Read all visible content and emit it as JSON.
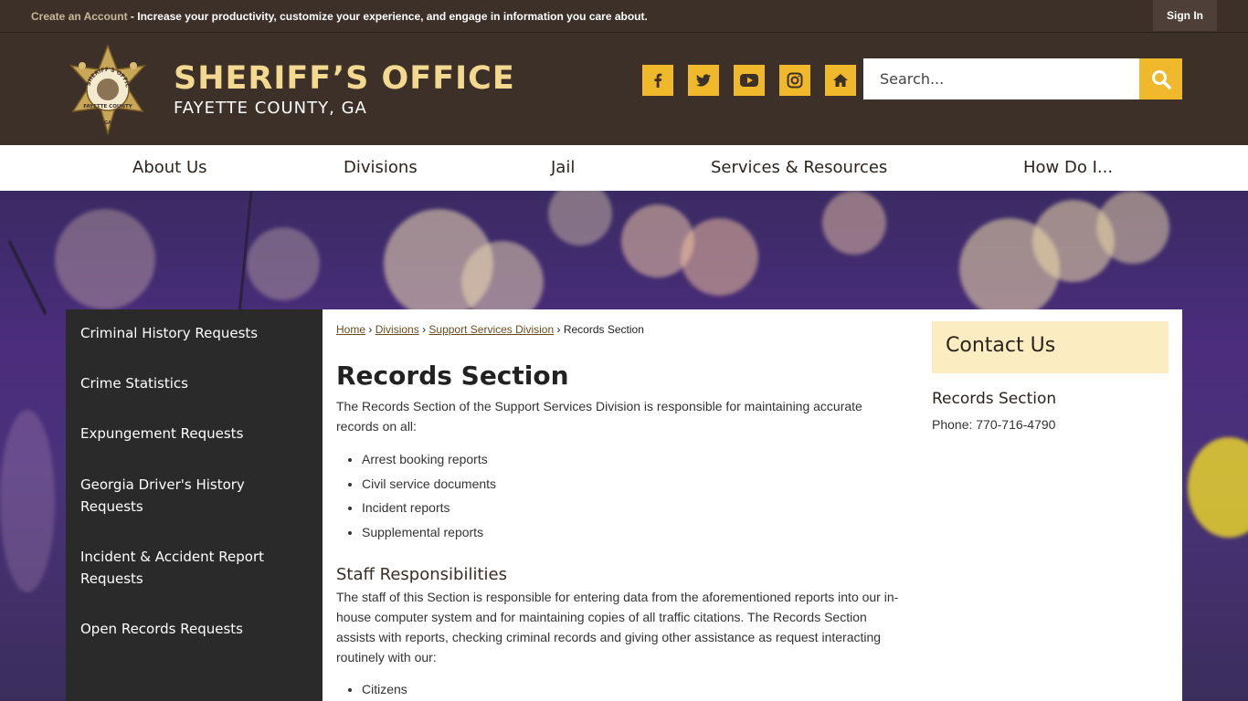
{
  "topbar": {
    "create_link": "Create an Account",
    "message": " - Increase your productivity, customize your experience, and engage in information you care about.",
    "sign_in": "Sign In"
  },
  "header": {
    "title": "SHERIFF’S OFFICE",
    "subtitle": "FAYETTE COUNTY, GA",
    "badge_text": [
      "SHERIFF'S OFFICE",
      "FAYETTE COUNTY",
      "GA"
    ],
    "social": [
      "facebook-icon",
      "twitter-icon",
      "youtube-icon",
      "instagram-icon",
      "nextdoor-icon"
    ],
    "search_placeholder": "Search..."
  },
  "nav": {
    "items": [
      "About Us",
      "Divisions",
      "Jail",
      "Services & Resources",
      "How Do I..."
    ]
  },
  "sidebar": {
    "items": [
      "Criminal History Requests",
      "Crime Statistics",
      "Expungement Requests",
      "Georgia Driver's History Requests",
      "Incident & Accident Report Requests",
      "Open Records Requests"
    ]
  },
  "breadcrumb": {
    "links": [
      "Home",
      "Divisions",
      "Support Services Division"
    ],
    "current": "Records Section"
  },
  "content": {
    "title": "Records Section",
    "intro": "The Records Section of the Support Services Division is responsible for maintaining accurate records on all:",
    "records": [
      "Arrest booking reports",
      "Civil service documents",
      "Incident reports",
      "Supplemental reports"
    ],
    "staff_heading": "Staff Responsibilities",
    "staff_text": "The staff of this Section is responsible for entering data from the aforementioned reports into our in-house computer system and for maintaining copies of all traffic citations. The Records Section assists with reports, checking criminal records and giving other assistance as request interacting routinely with our:",
    "interacting": [
      "Citizens"
    ]
  },
  "contact": {
    "heading": "Contact Us",
    "name": "Records Section",
    "phone": "Phone: 770-716-4790"
  },
  "colors": {
    "header_bg": "#3d3028",
    "accent": "#f0b82b",
    "title_gold": "#f3d88f",
    "contact_bg": "#fcecc1"
  }
}
